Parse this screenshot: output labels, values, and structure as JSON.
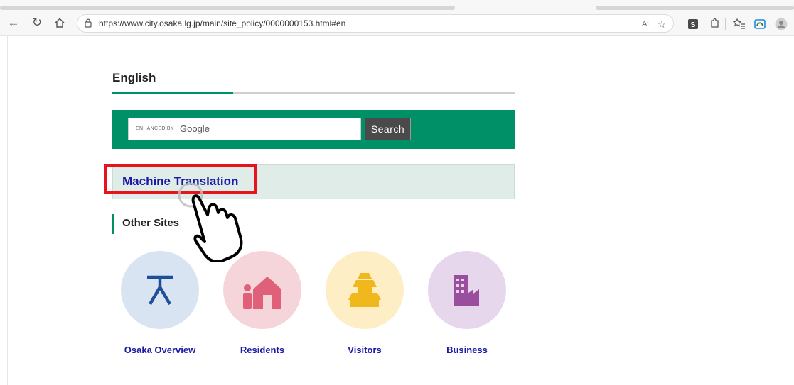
{
  "browser": {
    "url": "https://www.city.osaka.lg.jp/main/site_policy/0000000153.html#en"
  },
  "page": {
    "section_title": "English",
    "search": {
      "brand_prefix": "ENHANCED BY",
      "brand_name": "Google",
      "button_label": "Search"
    },
    "machine_translation_label": "Machine Translation",
    "other_sites_title": "Other Sites",
    "sites": [
      {
        "label": "Osaka Overview",
        "icon": "osaka-city-emblem-icon",
        "color": "#d9e4f2"
      },
      {
        "label": "Residents",
        "icon": "house-person-icon",
        "color": "#f6d5da"
      },
      {
        "label": "Visitors",
        "icon": "castle-icon",
        "color": "#fdeec6"
      },
      {
        "label": "Business",
        "icon": "factory-building-icon",
        "color": "#e6d7ec"
      }
    ]
  },
  "colors": {
    "accent_green": "#009068",
    "link_blue": "#1a1aa6",
    "highlight_red": "#e8141d"
  }
}
